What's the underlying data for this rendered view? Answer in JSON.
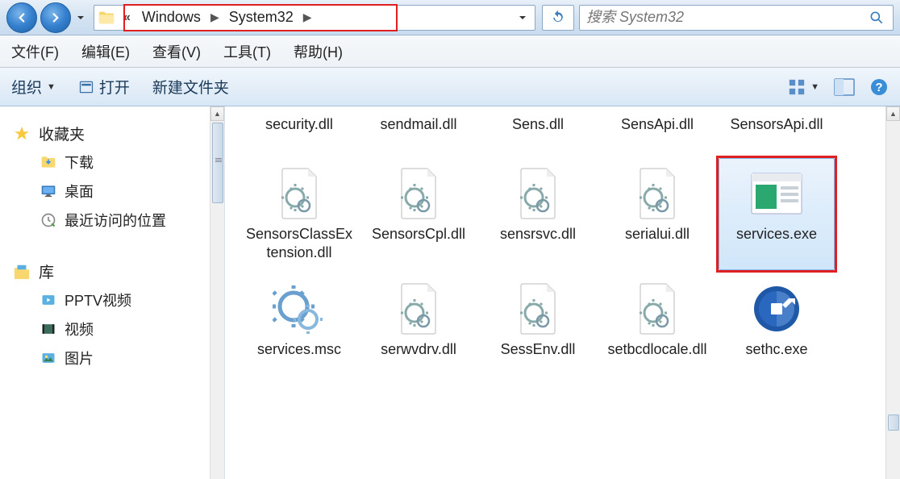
{
  "nav": {
    "breadcrumb": [
      "Windows",
      "System32"
    ]
  },
  "search": {
    "placeholder": "搜索 System32"
  },
  "menu": {
    "file": "文件(F)",
    "edit": "编辑(E)",
    "view": "查看(V)",
    "tools": "工具(T)",
    "help": "帮助(H)"
  },
  "toolbar": {
    "organize": "组织",
    "open": "打开",
    "new_folder": "新建文件夹"
  },
  "sidebar": {
    "favorites": "收藏夹",
    "downloads": "下载",
    "desktop": "桌面",
    "recent": "最近访问的位置",
    "libraries": "库",
    "pptv": "PPTV视频",
    "video": "视频",
    "pictures": "图片"
  },
  "files": {
    "row_top": [
      "security.dll",
      "sendmail.dll",
      "Sens.dll",
      "SensApi.dll",
      "SensorsApi.dll"
    ],
    "row2": [
      "SensorsClassExtension.dll",
      "SensorsCpl.dll",
      "sensrsvc.dll",
      "serialui.dll",
      "services.exe"
    ],
    "row3": [
      "services.msc",
      "serwvdrv.dll",
      "SessEnv.dll",
      "setbcdlocale.dll",
      "sethc.exe"
    ]
  }
}
